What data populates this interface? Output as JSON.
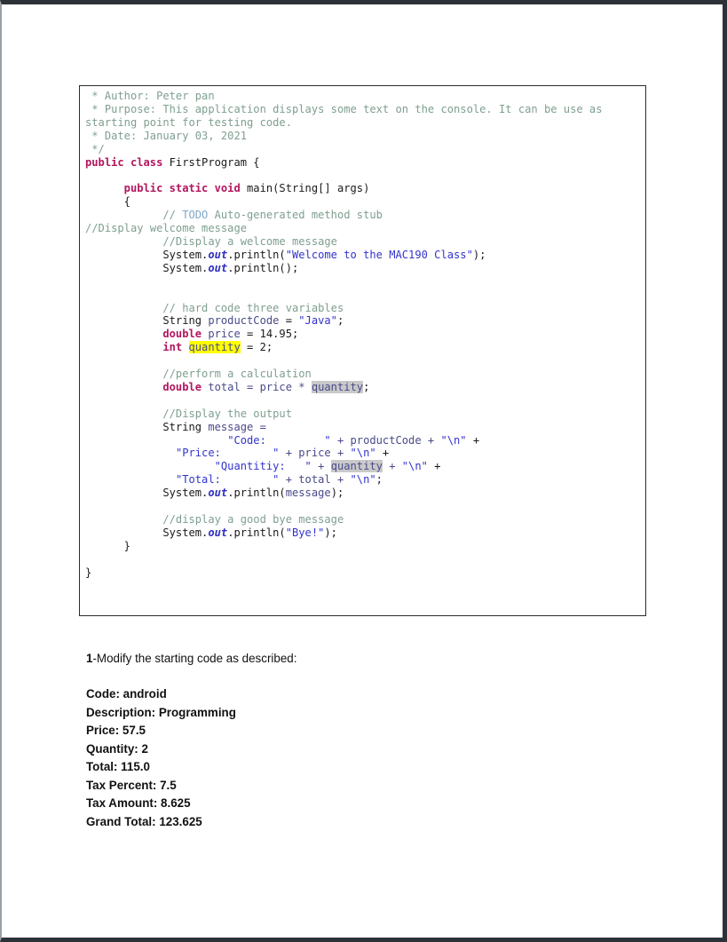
{
  "document": {
    "type": "java-assignment-worksheet",
    "background_color": "#ffffff",
    "frame_color": "#2d3238"
  },
  "code_block": {
    "border_color": "#2b2b2b",
    "language": "java",
    "class_name": "FirstProgram",
    "header_comment": {
      "author": " * Author: Peter pan",
      "purpose_line1": " * Purpose: This application displays some text on the console. It can be use as",
      "purpose_line2": "starting point for testing code.",
      "date": " * Date: January 03, 2021",
      "close": " */"
    },
    "tokens": {
      "kw_public": "public",
      "kw_class": "class",
      "kw_static": "static",
      "kw_void": "void",
      "kw_double": "double",
      "kw_int": "int",
      "type_string": "String",
      "ident_main": "main",
      "ident_args": "args",
      "ident_system": "System",
      "ident_out": "out",
      "ident_println": "println",
      "ident_productCode": "productCode",
      "ident_price": "price",
      "ident_quantity": "quantity",
      "ident_total": "total",
      "ident_message": "message"
    },
    "lines": {
      "class_decl_head": "public class",
      "class_decl_tail": " FirstProgram {",
      "main_sig_head": "      public static void ",
      "main_sig_tail": "main(String[] args)",
      "brace_open": "      {",
      "todo_prefix": "            // ",
      "todo_tag": "TODO",
      "todo_rest": " Auto-generated method stub",
      "display_welcome_outdent": "//Display welcome message",
      "comment_display_welcome": "            //Display a welcome message",
      "println_welcome_string": "\"Welcome to the MAC190 Class\"",
      "println_empty": "            System.out.println();",
      "comment_hardcode": "            // hard code three variables",
      "string_decl_value": "\"Java\"",
      "price_value": " = 14.95;",
      "quantity_value": " = 2;",
      "comment_calculation": "            //perform a calculation",
      "total_expr_head": " total = price * ",
      "total_expr_tail": ";",
      "comment_display_output": "            //Display the output",
      "message_decl": "            String message =",
      "concat_code": "                      \"Code:         \" + productCode + \"\\n\" +",
      "concat_price": "              \"Price:        \" + price + \"\\n\" +",
      "concat_quantity_pre": "                    \"Quantitiy:   \" + ",
      "concat_quantity_post": " + \"\\n\" +",
      "concat_total": "              \"Total:        \" + total + \"\\n\";",
      "println_message": "            System.out.println(message);",
      "comment_goodbye": "            //display a good bye message",
      "println_bye_string": "\"Bye!\"",
      "brace_close_inner": "      }",
      "brace_close_outer": "}"
    },
    "highlights": {
      "yellow_color": "#ffff00",
      "gray_color": "#c9c9c9",
      "highlighted_identifier": "quantity"
    }
  },
  "task": {
    "number": "1",
    "text": "-Modify the starting code as described:",
    "spec_items": [
      "Code: android",
      "Description: Programming",
      "Price: 57.5",
      "Quantity: 2",
      "Total: 115.0",
      "Tax Percent: 7.5",
      "Tax Amount: 8.625",
      "Grand Total: 123.625"
    ]
  }
}
